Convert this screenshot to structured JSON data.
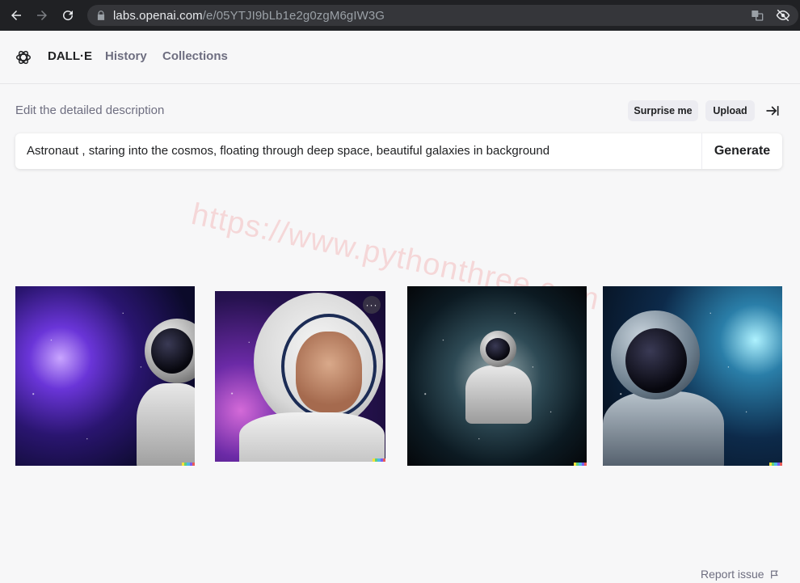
{
  "browser": {
    "url_host": "labs.openai.com",
    "url_path": "/e/05YTJI9bLb1e2g0zgM6gIW3G",
    "icons": [
      "back-icon",
      "forward-icon",
      "reload-icon",
      "lock-icon",
      "translate-icon",
      "eye-off-icon"
    ]
  },
  "header": {
    "logo_icon": "openai-logo-icon",
    "nav": [
      "DALL·E",
      "History",
      "Collections"
    ]
  },
  "editor": {
    "label": "Edit the detailed description",
    "surprise_label": "Surprise me",
    "upload_label": "Upload",
    "collapse_icon": "collapse-right-icon",
    "prompt_value": "Astronaut , staring into the cosmos, floating through deep space, beautiful galaxies in background",
    "generate_label": "Generate"
  },
  "watermark": "https://www.pythonthree.com",
  "results": {
    "images": [
      {
        "alt": "astronaut-image-1"
      },
      {
        "alt": "astronaut-image-2",
        "menu": "···"
      },
      {
        "alt": "astronaut-image-3"
      },
      {
        "alt": "astronaut-image-4"
      }
    ],
    "signature_colors": [
      "#f6e13a",
      "#5fd27a",
      "#4db7e8",
      "#7b5cf0",
      "#e85b5b"
    ]
  },
  "footer": {
    "report_label": "Report issue",
    "report_icon": "flag-icon"
  }
}
